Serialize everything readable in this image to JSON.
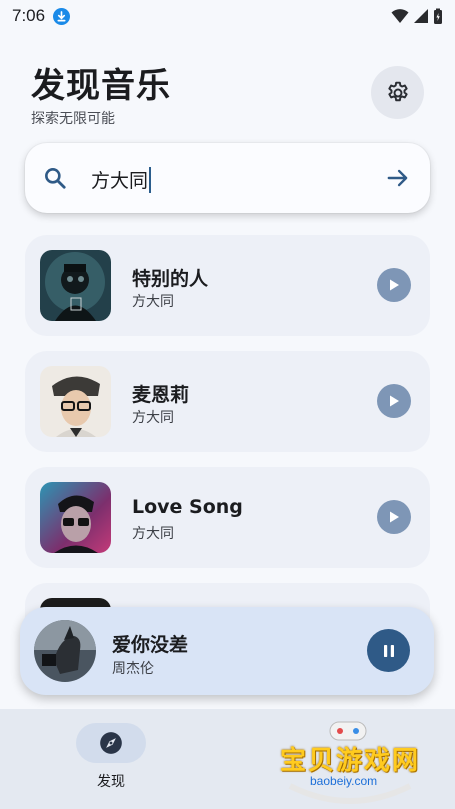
{
  "status_bar": {
    "time": "7:06",
    "icons": [
      "download-icon",
      "wifi-icon",
      "signal-icon",
      "battery-icon"
    ]
  },
  "header": {
    "title": "发现音乐",
    "subtitle": "探索无限可能",
    "settings_icon": "gear-icon"
  },
  "search": {
    "value": "方大同",
    "icon": "search-icon",
    "submit_icon": "arrow-right-icon"
  },
  "songs": [
    {
      "title": "特别的人",
      "artist": "方大同"
    },
    {
      "title": "麦恩莉",
      "artist": "方大同"
    },
    {
      "title": "Love Song",
      "artist": "方大同"
    }
  ],
  "now_playing": {
    "title": "爱你没差",
    "artist": "周杰伦",
    "state_icon": "pause-icon"
  },
  "bottom_nav": {
    "items": [
      {
        "label": "发现",
        "icon": "compass-icon",
        "active": true
      }
    ]
  },
  "watermark": {
    "text": "宝贝游戏网",
    "url": "baobeiy.com"
  },
  "colors": {
    "accent": "#2f5a87",
    "play_button": "#7e96b6",
    "card_bg": "#edf0f7",
    "now_playing_bg": "#d9e4f6",
    "background": "#f6f8fc"
  }
}
